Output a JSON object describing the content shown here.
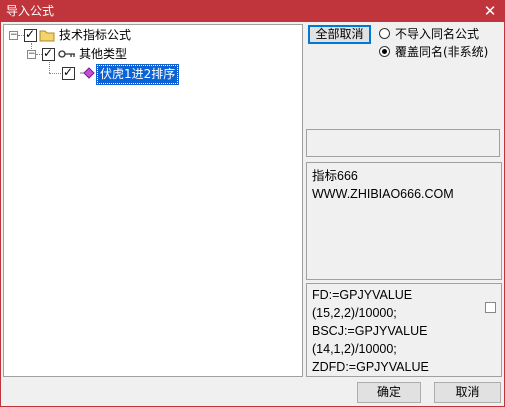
{
  "window": {
    "title": "导入公式",
    "close_glyph": "✕"
  },
  "tree": {
    "nodes": [
      {
        "label": "技术指标公式",
        "checked": true,
        "expanded": true,
        "icon": "folder-icon"
      },
      {
        "label": "其他类型",
        "checked": true,
        "expanded": true,
        "icon": "key-icon"
      },
      {
        "label": "伏虎1进2排序",
        "checked": true,
        "selected": true,
        "icon": "formula-icon"
      }
    ]
  },
  "actions": {
    "deselect_all_label": "全部取消"
  },
  "options": {
    "items": [
      {
        "label": "不导入同名公式",
        "selected": false
      },
      {
        "label": "覆盖同名(非系统)",
        "selected": true
      }
    ]
  },
  "info": {
    "text": "指标666\nWWW.ZHIBIAO666.COM"
  },
  "code": {
    "text": "FD:=GPJYVALUE\n(15,2,2)/10000;\nBSCJ:=GPJYVALUE\n(14,1,2)/10000;\nZDFD:=GPJYVALUE",
    "wrap_checked": false
  },
  "footer": {
    "ok_label": "确定",
    "cancel_label": "取消"
  },
  "colors": {
    "titlebar": "#c0353c",
    "selection": "#0a64d8"
  }
}
